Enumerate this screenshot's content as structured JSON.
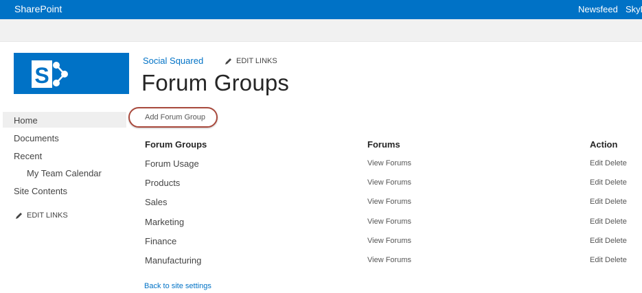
{
  "suitebar": {
    "brand": "SharePoint",
    "links": [
      "Newsfeed",
      "SkyD"
    ]
  },
  "colors": {
    "accent": "#0072c6",
    "highlight_ring": "#a8483b"
  },
  "header": {
    "site_link": "Social Squared",
    "edit_links": "EDIT LINKS",
    "page_title": "Forum Groups",
    "logo_icon": "sharepoint-logo-icon"
  },
  "nav": {
    "items": [
      "Home",
      "Documents",
      "Recent",
      "My Team Calendar",
      "Site Contents"
    ],
    "edit_links": "EDIT LINKS"
  },
  "actions": {
    "add_label": "Add Forum Group"
  },
  "table": {
    "headers": [
      "Forum Groups",
      "Forums",
      "Action"
    ],
    "rows": [
      {
        "name": "Forum Usage",
        "forums": "View Forums",
        "action": "Edit Delete"
      },
      {
        "name": "Products",
        "forums": "View Forums",
        "action": "Edit Delete"
      },
      {
        "name": "Sales",
        "forums": "View Forums",
        "action": "Edit Delete"
      },
      {
        "name": "Marketing",
        "forums": "View Forums",
        "action": "Edit Delete"
      },
      {
        "name": "Finance",
        "forums": "View Forums",
        "action": "Edit Delete"
      },
      {
        "name": "Manufacturing",
        "forums": "View Forums",
        "action": "Edit Delete"
      }
    ]
  },
  "footer": {
    "back_link": "Back to site settings"
  }
}
